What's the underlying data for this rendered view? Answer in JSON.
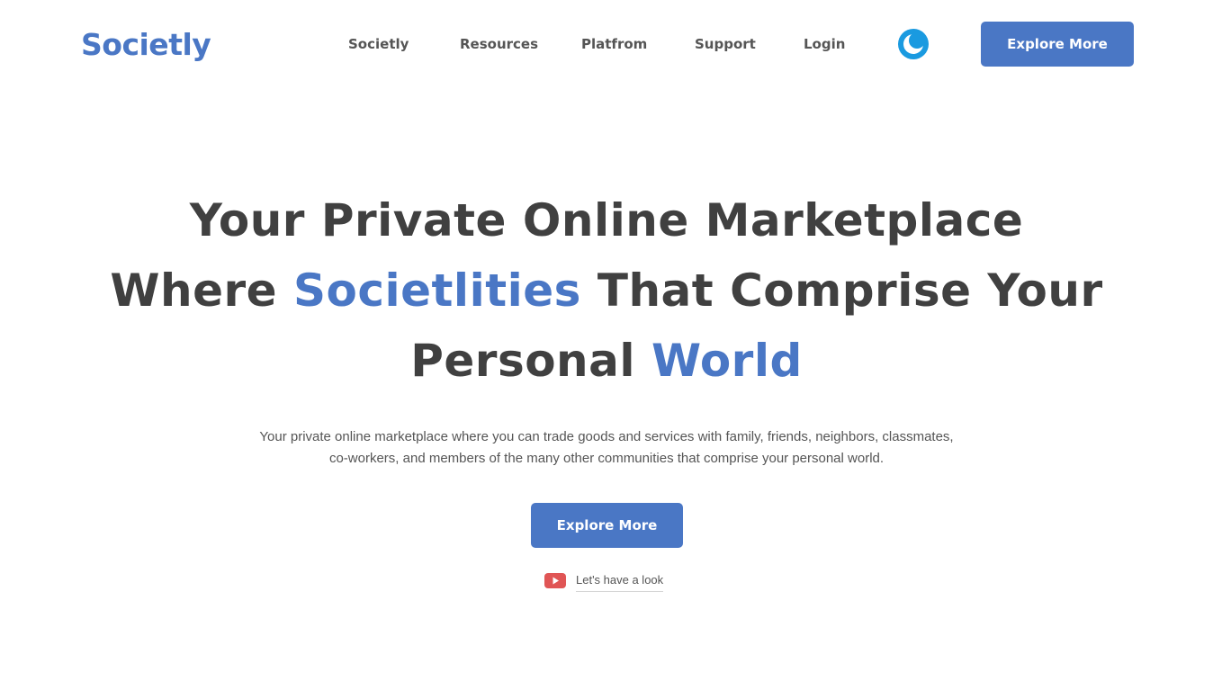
{
  "header": {
    "logo": "Societly",
    "nav": [
      "Societly",
      "Resources",
      "Platfrom",
      "Support",
      "Login"
    ],
    "theme_toggle_icon": "moon-icon",
    "cta_label": "Explore More"
  },
  "hero": {
    "headline": {
      "line1": "Your Private Online Marketplace",
      "line2_start": "Where ",
      "line2_accent": "Societlities",
      "line2_end": " That Comprise Your",
      "line3_start": "Personal ",
      "line3_accent": "World"
    },
    "subtext": {
      "line1": "Your private online marketplace where you can trade goods and services with family, friends, neighbors, classmates,",
      "line2": "co-workers, and members of the many other communities that comprise your personal world."
    },
    "cta_label": "Explore More",
    "video_link": {
      "icon": "youtube-play-icon",
      "label": "Let's have a look"
    }
  },
  "colors": {
    "brand": "#4a77c5",
    "heading": "#404040",
    "toggle": "#1a9ae0",
    "video_icon": "#e05555"
  }
}
